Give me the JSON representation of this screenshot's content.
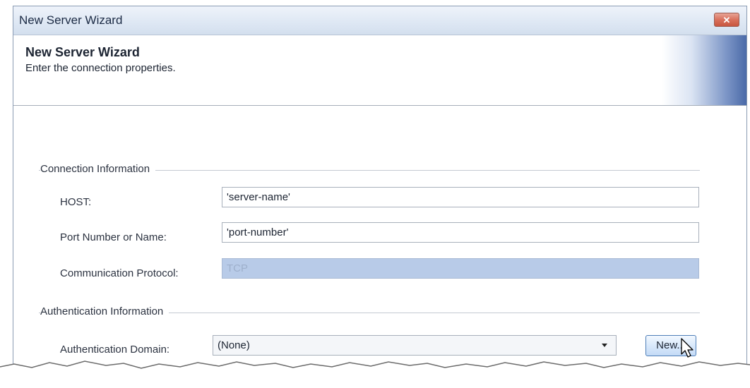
{
  "window": {
    "title": "New Server Wizard",
    "close_glyph": "✕"
  },
  "header": {
    "heading": "New Server Wizard",
    "subheading": "Enter the connection properties."
  },
  "connection": {
    "section_label": "Connection Information",
    "host_label": "HOST:",
    "host_value": "'server-name'",
    "port_label": "Port Number or Name:",
    "port_value": "'port-number'",
    "protocol_label": "Communication Protocol:",
    "protocol_value": "TCP"
  },
  "authentication": {
    "section_label": "Authentication Information",
    "domain_label": "Authentication Domain:",
    "domain_value": "(None)",
    "new_button": "New..."
  },
  "colors": {
    "title_bar": "#dfe8f4",
    "close_button": "#d9705c",
    "disabled_field": "#b8cbe8",
    "button_border": "#4f7fb8"
  },
  "icons": {
    "cursor": "mouse-pointer-icon",
    "close": "close-icon",
    "dropdown": "chevron-down-icon"
  }
}
